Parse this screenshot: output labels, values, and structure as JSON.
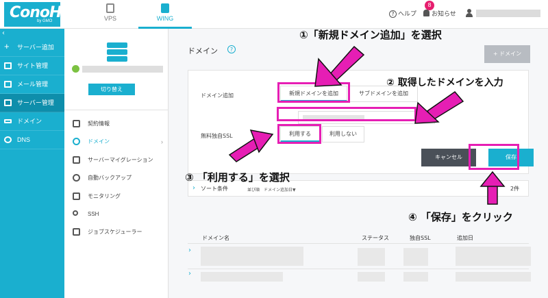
{
  "header": {
    "logo": "ConoHa",
    "logo_sub": "by GMO",
    "tabs": [
      {
        "label": "VPS"
      },
      {
        "label": "WING"
      }
    ],
    "help": "ヘルプ",
    "notice": "お知らせ",
    "notice_count": "8"
  },
  "sidebar": {
    "items": [
      {
        "label": "サーバー追加",
        "icon": "plus-icon"
      },
      {
        "label": "サイト管理",
        "icon": "site-icon"
      },
      {
        "label": "メール管理",
        "icon": "mail-icon"
      },
      {
        "label": "サーバー管理",
        "icon": "server-icon",
        "active": true
      },
      {
        "label": "ドメイン",
        "icon": "domain-icon"
      },
      {
        "label": "DNS",
        "icon": "globe-icon"
      }
    ]
  },
  "server_panel": {
    "switch_label": "切り替え",
    "menu": [
      {
        "label": "契約情報"
      },
      {
        "label": "ドメイン",
        "active": true
      },
      {
        "label": "サーバーマイグレーション"
      },
      {
        "label": "自動バックアップ"
      },
      {
        "label": "モニタリング"
      },
      {
        "label": "SSH"
      },
      {
        "label": "ジョブスケジューラー"
      }
    ]
  },
  "main": {
    "title": "ドメイン",
    "add_domain_button": "+ ドメイン",
    "form": {
      "domain_add_label": "ドメイン追加",
      "new_domain_tab": "新規ドメインを追加",
      "sub_domain_tab": "サブドメインを追加",
      "ssl_label": "無料独自SSL",
      "ssl_use": "利用する",
      "ssl_no_use": "利用しない",
      "cancel": "キャンセル",
      "save": "保存"
    },
    "sort": {
      "title": "ソート条件",
      "order": "並び順　ドメイン追加日▼",
      "count": "2件"
    },
    "table": {
      "headers": [
        "ドメイン名",
        "ステータス",
        "独自SSL",
        "追加日"
      ]
    }
  },
  "annotations": {
    "step1": "①「新規ドメイン追加」を選択",
    "step2": "② 取得したドメインを入力",
    "step3": "③ 「利用する」を選択",
    "step4": "④ 「保存」をクリック"
  },
  "colors": {
    "accent": "#1aafcf",
    "highlight": "#e61eb4",
    "badge": "#e61e6e"
  }
}
